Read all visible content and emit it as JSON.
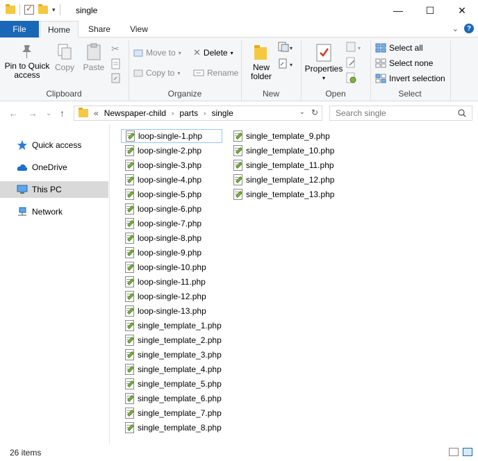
{
  "window": {
    "title": "single"
  },
  "controls": {
    "minimize": "—",
    "maximize": "☐",
    "close": "✕"
  },
  "tabs": [
    {
      "label": "File"
    },
    {
      "label": "Home"
    },
    {
      "label": "Share"
    },
    {
      "label": "View"
    }
  ],
  "ribbon": {
    "clipboard": {
      "label": "Clipboard",
      "pin": "Pin to Quick access",
      "pin_l1": "Pin to Quick",
      "pin_l2": "access",
      "copy": "Copy",
      "paste": "Paste"
    },
    "organize": {
      "label": "Organize",
      "move_to": "Move to",
      "copy_to": "Copy to",
      "delete": "Delete",
      "rename": "Rename"
    },
    "new": {
      "label": "New",
      "new_folder_l1": "New",
      "new_folder_l2": "folder"
    },
    "open": {
      "label": "Open",
      "properties": "Properties"
    },
    "select": {
      "label": "Select",
      "select_all": "Select all",
      "select_none": "Select none",
      "invert": "Invert selection"
    }
  },
  "address": {
    "overflow": "«",
    "crumbs": [
      "Newspaper-child",
      "parts",
      "single"
    ]
  },
  "search": {
    "placeholder": "Search single"
  },
  "nav": [
    {
      "label": "Quick access",
      "icon": "star-icon"
    },
    {
      "label": "OneDrive",
      "icon": "cloud-icon"
    },
    {
      "label": "This PC",
      "icon": "computer-icon"
    },
    {
      "label": "Network",
      "icon": "network-icon"
    }
  ],
  "files": [
    "loop-single-1.php",
    "loop-single-2.php",
    "loop-single-3.php",
    "loop-single-4.php",
    "loop-single-5.php",
    "loop-single-6.php",
    "loop-single-7.php",
    "loop-single-8.php",
    "loop-single-9.php",
    "loop-single-10.php",
    "loop-single-11.php",
    "loop-single-12.php",
    "loop-single-13.php",
    "single_template_1.php",
    "single_template_2.php",
    "single_template_3.php",
    "single_template_4.php",
    "single_template_5.php",
    "single_template_6.php",
    "single_template_7.php",
    "single_template_8.php",
    "single_template_9.php",
    "single_template_10.php",
    "single_template_11.php",
    "single_template_12.php",
    "single_template_13.php"
  ],
  "status": {
    "count": "26 items"
  },
  "colors": {
    "accent": "#1a67b7",
    "selected_nav": "#d9d9d9"
  }
}
